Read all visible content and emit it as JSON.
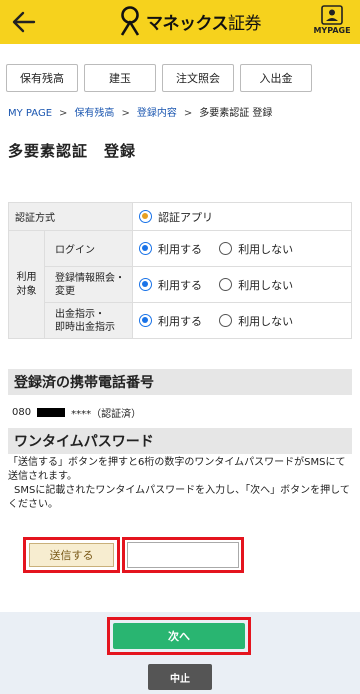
{
  "header": {
    "back_icon": "arrow-left-icon",
    "logo_name": "マネックス",
    "logo_suffix": "証券",
    "mypage_label": "MYPAGE",
    "background_color": "#f6d21d"
  },
  "tabs": [
    {
      "label": "保有残高"
    },
    {
      "label": "建玉"
    },
    {
      "label": "注文照会"
    },
    {
      "label": "入出金"
    }
  ],
  "breadcrumb": {
    "items": [
      "MY PAGE",
      "保有残高",
      "登録内容",
      "多要素認証 登録"
    ],
    "separator": ">"
  },
  "page_title": "多要素認証　登録",
  "auth_table": {
    "method_label": "認証方式",
    "method_value": "認証アプリ",
    "usage_label_1": "利用",
    "usage_label_2": "対象",
    "rows": [
      {
        "label": "ログイン",
        "label2": "",
        "selected": "利用する",
        "other": "利用しない"
      },
      {
        "label": "登録情報照会・",
        "label2": "変更",
        "selected": "利用する",
        "other": "利用しない"
      },
      {
        "label": "出金指示・",
        "label2": "即時出金指示",
        "selected": "利用する",
        "other": "利用しない"
      }
    ]
  },
  "phone_section": {
    "title": "登録済の携帯電話番号",
    "prefix": "080",
    "suffix": "****（認証済）"
  },
  "otp_section": {
    "title": "ワンタイムパスワード",
    "desc_1": "「送信する」ボタンを押すと6桁の数字のワンタイムパスワードがSMSにて送信されます。",
    "desc_2": "SMSに記載されたワンタイムパスワードを入力し、「次へ」ボタンを押してください。",
    "send_label": "送信する",
    "input_value": ""
  },
  "footer": {
    "next_label": "次へ",
    "cancel_label": "中止"
  },
  "colors": {
    "accent": "#f6d21d",
    "next_button": "#29b571",
    "highlight": "#e4141e",
    "link": "#1a56b0"
  }
}
